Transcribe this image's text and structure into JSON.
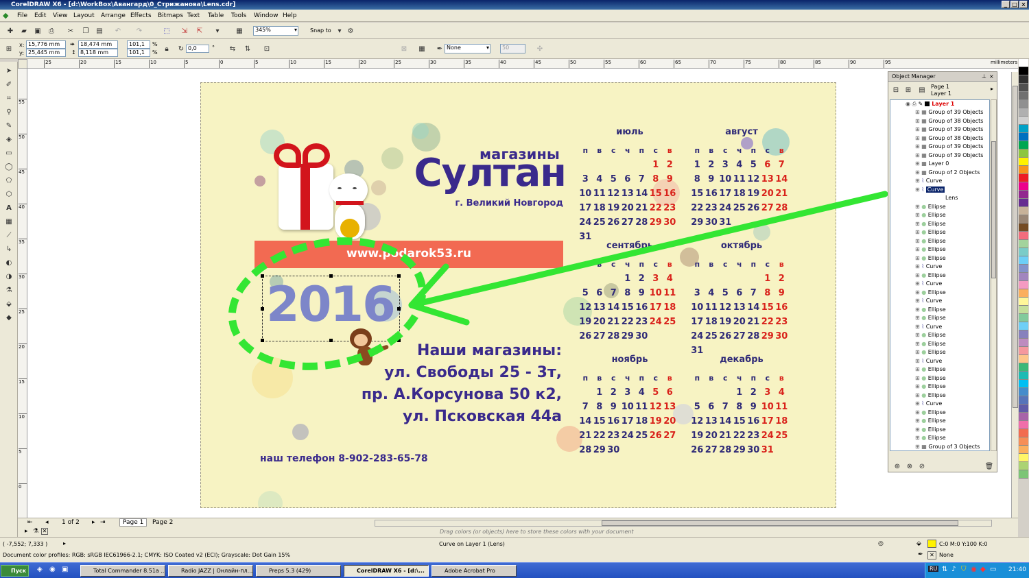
{
  "window": {
    "title": "CorelDRAW X6 - [d:\\WorkBox\\Авангард\\0_Стрижанова\\Lens.cdr]"
  },
  "menu": [
    "File",
    "Edit",
    "View",
    "Layout",
    "Arrange",
    "Effects",
    "Bitmaps",
    "Text",
    "Table",
    "Tools",
    "Window",
    "Help"
  ],
  "toolbar": {
    "zoom": "345%",
    "snap_label": "Snap to"
  },
  "propbar": {
    "x": "15,776 mm",
    "y": "25,445 mm",
    "w": "18,474 mm",
    "h": "8,118 mm",
    "scale_x": "101,1",
    "scale_y": "101,1",
    "pct": "%",
    "angle": "0,0",
    "angle_unit": "°",
    "outline": "None",
    "size": "50"
  },
  "ruler": {
    "unit": "millimeters",
    "h_ticks": [
      "25",
      "20",
      "15",
      "10",
      "5",
      "0",
      "5",
      "10",
      "15",
      "20",
      "25",
      "30",
      "35",
      "40",
      "45",
      "50",
      "55",
      "60",
      "65",
      "70",
      "75",
      "80",
      "85",
      "90",
      "95"
    ],
    "v_ticks": [
      "55",
      "50",
      "45",
      "40",
      "35",
      "30",
      "25",
      "20",
      "15",
      "10",
      "5",
      "0"
    ]
  },
  "design": {
    "shops_label": "магазины",
    "brand": "Султан",
    "city": "г. Великий Новгород",
    "website": "www.podarok53.ru",
    "year": "2016",
    "stores_title": "Наши магазины:",
    "addresses": [
      "ул. Свободы 25 - 3т,",
      "пр. А.Корсунова 50 к2,",
      "ул. Псковская 44а"
    ],
    "phone": "наш телефон 8-902-283-65-78",
    "colors": {
      "paper": "#f7f3c3",
      "brand": "#3a2a8c",
      "weekend": "#d9221b",
      "banner": "#f26a52",
      "highlight": "#33e633"
    }
  },
  "calendar": {
    "day_headers": [
      "п",
      "в",
      "с",
      "ч",
      "п",
      "с",
      "в"
    ],
    "months": [
      {
        "name": "июль",
        "cells": [
          "",
          "",
          "",
          "",
          "",
          "1",
          "2",
          "3",
          "4",
          "5",
          "6",
          "7",
          "8",
          "9",
          "10",
          "11",
          "12",
          "13",
          "14",
          "15",
          "16",
          "17",
          "18",
          "19",
          "20",
          "21",
          "22",
          "23",
          "24",
          "25",
          "26",
          "27",
          "28",
          "29",
          "30",
          "31"
        ]
      },
      {
        "name": "август",
        "cells": [
          "1",
          "2",
          "3",
          "4",
          "5",
          "6",
          "7",
          "8",
          "9",
          "10",
          "11",
          "12",
          "13",
          "14",
          "15",
          "16",
          "17",
          "18",
          "19",
          "20",
          "21",
          "22",
          "23",
          "24",
          "25",
          "26",
          "27",
          "28",
          "29",
          "30",
          "31"
        ]
      },
      {
        "name": "сентябрь",
        "cells": [
          "",
          "",
          "",
          "1",
          "2",
          "3",
          "4",
          "5",
          "6",
          "7",
          "8",
          "9",
          "10",
          "11",
          "12",
          "13",
          "14",
          "15",
          "16",
          "17",
          "18",
          "19",
          "20",
          "21",
          "22",
          "23",
          "24",
          "25",
          "26",
          "27",
          "28",
          "29",
          "30"
        ]
      },
      {
        "name": "октябрь",
        "cells": [
          "",
          "",
          "",
          "",
          "",
          "1",
          "2",
          "3",
          "4",
          "5",
          "6",
          "7",
          "8",
          "9",
          "10",
          "11",
          "12",
          "13",
          "14",
          "15",
          "16",
          "17",
          "18",
          "19",
          "20",
          "21",
          "22",
          "23",
          "24",
          "25",
          "26",
          "27",
          "28",
          "29",
          "30",
          "31"
        ]
      },
      {
        "name": "ноябрь",
        "cells": [
          "",
          "1",
          "2",
          "3",
          "4",
          "5",
          "6",
          "7",
          "8",
          "9",
          "10",
          "11",
          "12",
          "13",
          "14",
          "15",
          "16",
          "17",
          "18",
          "19",
          "20",
          "21",
          "22",
          "23",
          "24",
          "25",
          "26",
          "27",
          "28",
          "29",
          "30"
        ]
      },
      {
        "name": "декабрь",
        "cells": [
          "",
          "",
          "",
          "1",
          "2",
          "3",
          "4",
          "5",
          "6",
          "7",
          "8",
          "9",
          "10",
          "11",
          "12",
          "13",
          "14",
          "15",
          "16",
          "17",
          "18",
          "19",
          "20",
          "21",
          "22",
          "23",
          "24",
          "25",
          "26",
          "27",
          "28",
          "29",
          "30",
          "31"
        ]
      }
    ]
  },
  "object_manager": {
    "title": "Object Manager",
    "page": "Page 1",
    "layer": "Layer 1",
    "layer_row": "Layer 1",
    "items": [
      "Group of 39 Objects",
      "Group of 38 Objects",
      "Group of 39 Objects",
      "Group of 38 Objects",
      "Group of 39 Objects",
      "Group of 39 Objects",
      "Layer 0",
      "Group of 2 Objects",
      "Curve",
      "Curve",
      "Lens",
      "Ellipse",
      "Ellipse",
      "Ellipse",
      "Ellipse",
      "Ellipse",
      "Ellipse",
      "Ellipse",
      "Curve",
      "Ellipse",
      "Curve",
      "Ellipse",
      "Curve",
      "Ellipse",
      "Ellipse",
      "Curve",
      "Ellipse",
      "Ellipse",
      "Ellipse",
      "Curve",
      "Ellipse",
      "Ellipse",
      "Ellipse",
      "Ellipse",
      "Curve",
      "Ellipse",
      "Ellipse",
      "Ellipse",
      "Ellipse",
      "Group of 3 Objects"
    ]
  },
  "pages": {
    "counter": "1 of 2",
    "tabs": [
      "Page 1",
      "Page 2"
    ]
  },
  "status": {
    "coords": "( -7,552; 7,333 )",
    "object_info": "Curve on Layer 1  (Lens)",
    "color_profiles": "Document color profiles: RGB: sRGB IEC61966-2.1; CMYK: ISO Coated v2 (ECI); Grayscale: Dot Gain 15%",
    "fill": "C:0 M:0 Y:100 K:0",
    "outline": "None",
    "palette_hint": "Drag colors (or objects) here to store these colors with your document"
  },
  "taskbar": {
    "start": "Пуск",
    "tasks": [
      "Total Commander 8.51a ...",
      "Radio JAZZ | Онлайн-пл...",
      "Preps 5.3 (429)",
      "CorelDRAW X6 - [d:\\...",
      "Adobe Acrobat Pro"
    ],
    "clock": "21:40",
    "lang": "RU"
  },
  "palette_colors": [
    "#ffffff",
    "#000000",
    "#303030",
    "#505050",
    "#707070",
    "#909090",
    "#b0b0b0",
    "#d0d0d0",
    "#00a0c6",
    "#0070c0",
    "#00a651",
    "#8dc63f",
    "#fff200",
    "#f7941d",
    "#ed1c24",
    "#ec008c",
    "#92278f",
    "#662d91",
    "#c7b299",
    "#998675",
    "#754c24",
    "#f26d7d",
    "#a3d39c",
    "#7accc8",
    "#6dcff6",
    "#8393ca",
    "#a186be",
    "#f49ac1",
    "#fbaf5d",
    "#fff799",
    "#c4df9b",
    "#82ca9c",
    "#6ecff6",
    "#8781bd",
    "#bd8cbf",
    "#f5989d",
    "#fdc68a",
    "#3cb878",
    "#1cbbb4",
    "#00bff3",
    "#448ccb",
    "#5674b9",
    "#605ca8",
    "#a864a8",
    "#f06eaa",
    "#f26c4f",
    "#f68e56",
    "#fbaf5d",
    "#fff568",
    "#acd373",
    "#7cc576"
  ]
}
